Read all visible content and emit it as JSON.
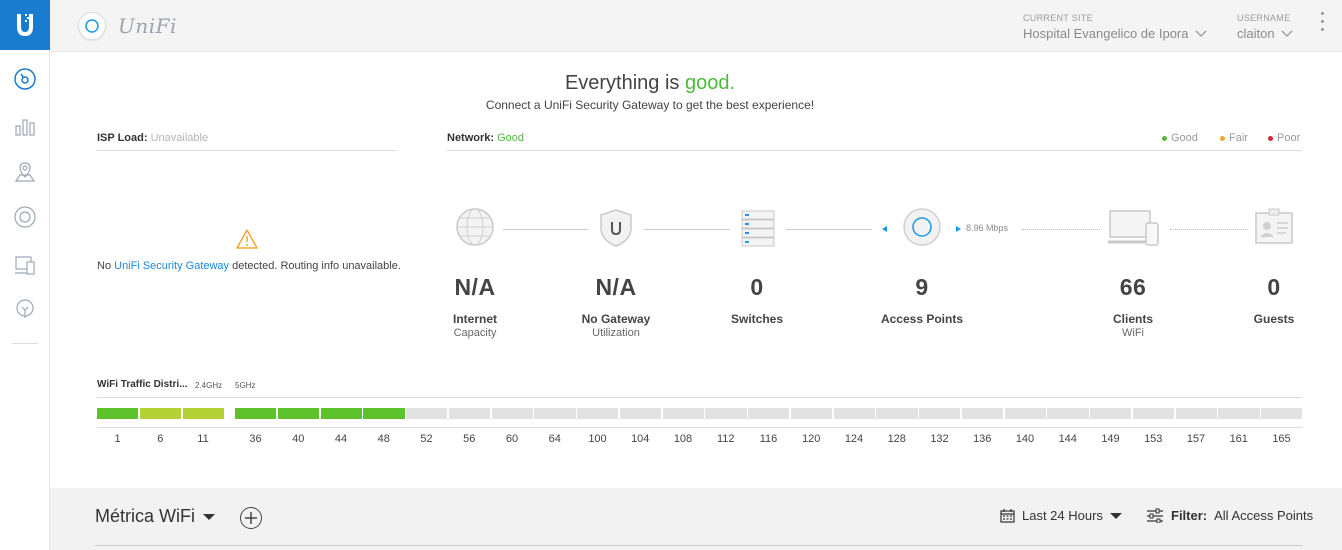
{
  "header": {
    "brand": "UniFi",
    "current_site_label": "CURRENT SITE",
    "current_site": "Hospital Evangelico de Ipora",
    "username_label": "USERNAME",
    "username": "claiton"
  },
  "status": {
    "headline_prefix": "Everything is",
    "headline_status": "good.",
    "subline": "Connect a UniFi Security Gateway to get the best experience!"
  },
  "isp": {
    "label": "ISP Load:",
    "value": "Unavailable",
    "message_prefix": "No",
    "message_link": "UniFi Security Gateway",
    "message_suffix": "detected. Routing info unavailable."
  },
  "network": {
    "label": "Network:",
    "value": "Good",
    "legend": [
      {
        "label": "Good",
        "color": "#4cba3a"
      },
      {
        "label": "Fair",
        "color": "#f0a830"
      },
      {
        "label": "Poor",
        "color": "#d9262c"
      }
    ],
    "throughput": "8.96 Mbps"
  },
  "topology": {
    "internet": {
      "value": "N/A",
      "label": "Internet",
      "sub": "Capacity"
    },
    "gateway": {
      "value": "N/A",
      "label": "No Gateway",
      "sub": "Utilization"
    },
    "switches": {
      "value": "0",
      "label": "Switches"
    },
    "access_points": {
      "value": "9",
      "label": "Access Points"
    },
    "clients": {
      "value": "66",
      "label": "Clients",
      "sub": "WiFi"
    },
    "guests": {
      "value": "0",
      "label": "Guests"
    }
  },
  "wifi_traffic": {
    "title": "WiFi Traffic Distri...",
    "band_24": "2.4GHz",
    "band_5": "5GHz",
    "channels_24": [
      {
        "ch": "1",
        "level": "high"
      },
      {
        "ch": "6",
        "level": "medium"
      },
      {
        "ch": "11",
        "level": "medium"
      }
    ],
    "channels_5": [
      {
        "ch": "36",
        "level": "high"
      },
      {
        "ch": "40",
        "level": "high"
      },
      {
        "ch": "44",
        "level": "high"
      },
      {
        "ch": "48",
        "level": "high"
      },
      {
        "ch": "52",
        "level": "none"
      },
      {
        "ch": "56",
        "level": "none"
      },
      {
        "ch": "60",
        "level": "none"
      },
      {
        "ch": "64",
        "level": "none"
      },
      {
        "ch": "100",
        "level": "none"
      },
      {
        "ch": "104",
        "level": "none"
      },
      {
        "ch": "108",
        "level": "none"
      },
      {
        "ch": "112",
        "level": "none"
      },
      {
        "ch": "116",
        "level": "none"
      },
      {
        "ch": "120",
        "level": "none"
      },
      {
        "ch": "124",
        "level": "none"
      },
      {
        "ch": "128",
        "level": "none"
      },
      {
        "ch": "132",
        "level": "none"
      },
      {
        "ch": "136",
        "level": "none"
      },
      {
        "ch": "140",
        "level": "none"
      },
      {
        "ch": "144",
        "level": "none"
      },
      {
        "ch": "149",
        "level": "none"
      },
      {
        "ch": "153",
        "level": "none"
      },
      {
        "ch": "157",
        "level": "none"
      },
      {
        "ch": "161",
        "level": "none"
      },
      {
        "ch": "165",
        "level": "none"
      }
    ],
    "level_colors": {
      "high": "#5ec22c",
      "medium": "#b4d236",
      "none": "#e2e2e2"
    }
  },
  "metrics": {
    "title": "Métrica WiFi",
    "time_range": "Last 24 Hours",
    "filter_label": "Filter:",
    "filter_value": "All Access Points"
  },
  "colors": {
    "accent_blue": "#1a7ccf",
    "good_green": "#4cba3a"
  },
  "sidebar": {
    "items": [
      {
        "icon": "dashboard-icon"
      },
      {
        "icon": "statistics-icon"
      },
      {
        "icon": "map-icon"
      },
      {
        "icon": "devices-icon"
      },
      {
        "icon": "clients-icon"
      },
      {
        "icon": "insights-icon"
      }
    ]
  }
}
